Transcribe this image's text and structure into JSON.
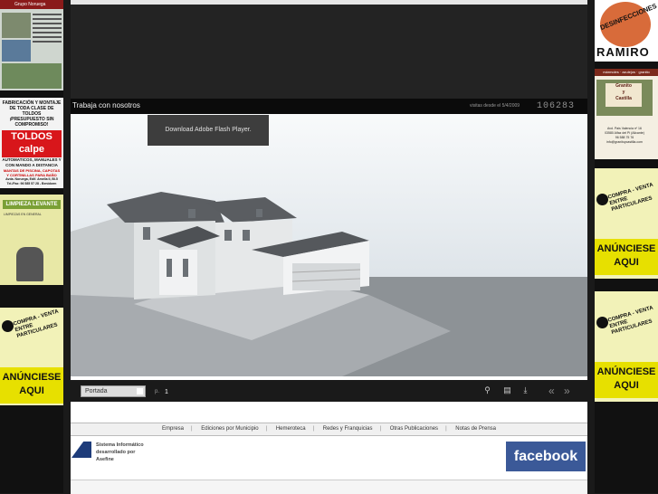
{
  "left_ads": {
    "grupo": {
      "header": "Grupo Noruega"
    },
    "toldos": {
      "line1": "FABRICACIÓN Y MONTAJE",
      "line2": "DE TODA CLASE DE TOLDOS",
      "line3": "¡PRESUPUESTO SIN COMPROMISO!",
      "brand1": "TOLDOS",
      "brand2": "calpe",
      "line4": "AUTOMATICOS, MANUALES Y",
      "line5": "CON MANDO A DISTANCIA",
      "line6": "MANTAS DE PISCINA, CAPOTAS",
      "line7": "Y CORTINILLAS PARA BAÑO",
      "addr": "Avda. Noruega, Edif. Amelia II, Bl.5",
      "tel": "Tel./Fax: 96 585 57 28 - Benidorm"
    },
    "limpieza": {
      "title": "LIMPIEZA LEVANTE",
      "sub": "LIMPIEZAS EN GENERAL"
    },
    "anunciese": {
      "cv1": "COMPRA - VENTA",
      "cv2": "ENTRE PARTICULARES",
      "b1": "ANÚNCIESE",
      "b2": "AQUI"
    }
  },
  "right_ads": {
    "desinf": {
      "title": "DESINFECCIONES",
      "name": "RAMIRO"
    },
    "granito": {
      "top": "mármoles · azulejos · granito",
      "plate1": "Granito",
      "plate2": "y",
      "plate3": "Castilla",
      "addr1": "Avd. Pais Valencia nº 16",
      "addr2": "03580 Alfaz del Pi (Alicante)",
      "addr3": "96 588 75 76",
      "addr4": "info@granitoycastilla.com"
    },
    "anunciese1": {
      "cv1": "COMPRA - VENTA",
      "cv2": "ENTRE PARTICULARES",
      "b1": "ANÚNCIESE",
      "b2": "AQUI"
    },
    "anunciese2": {
      "cv1": "COMPRA - VENTA",
      "cv2": "ENTRE PARTICULARES",
      "b1": "ANÚNCIESE",
      "b2": "AQUI"
    }
  },
  "header": {
    "title": "Trabaja con nosotros",
    "visits_label": "visitas desde el 5/4/2009",
    "visits_count": "106283"
  },
  "viewer": {
    "flash_message": "Download Adobe Flash Player.",
    "page_select": "Portada",
    "page_label": "p.",
    "page_number": "1",
    "icons": [
      "zoom-icon",
      "print-icon",
      "download-icon",
      "previous-icon",
      "next-icon"
    ]
  },
  "menu": [
    "Empresa",
    "Ediciones por Municipio",
    "Hemeroteca",
    "Redes y Franquicias",
    "Otras Publicaciones",
    "Notas de Prensa"
  ],
  "footer": {
    "line1": "Sistema Informático",
    "line2": "desarrollado por",
    "line3": "Asefine",
    "facebook": "facebook"
  }
}
